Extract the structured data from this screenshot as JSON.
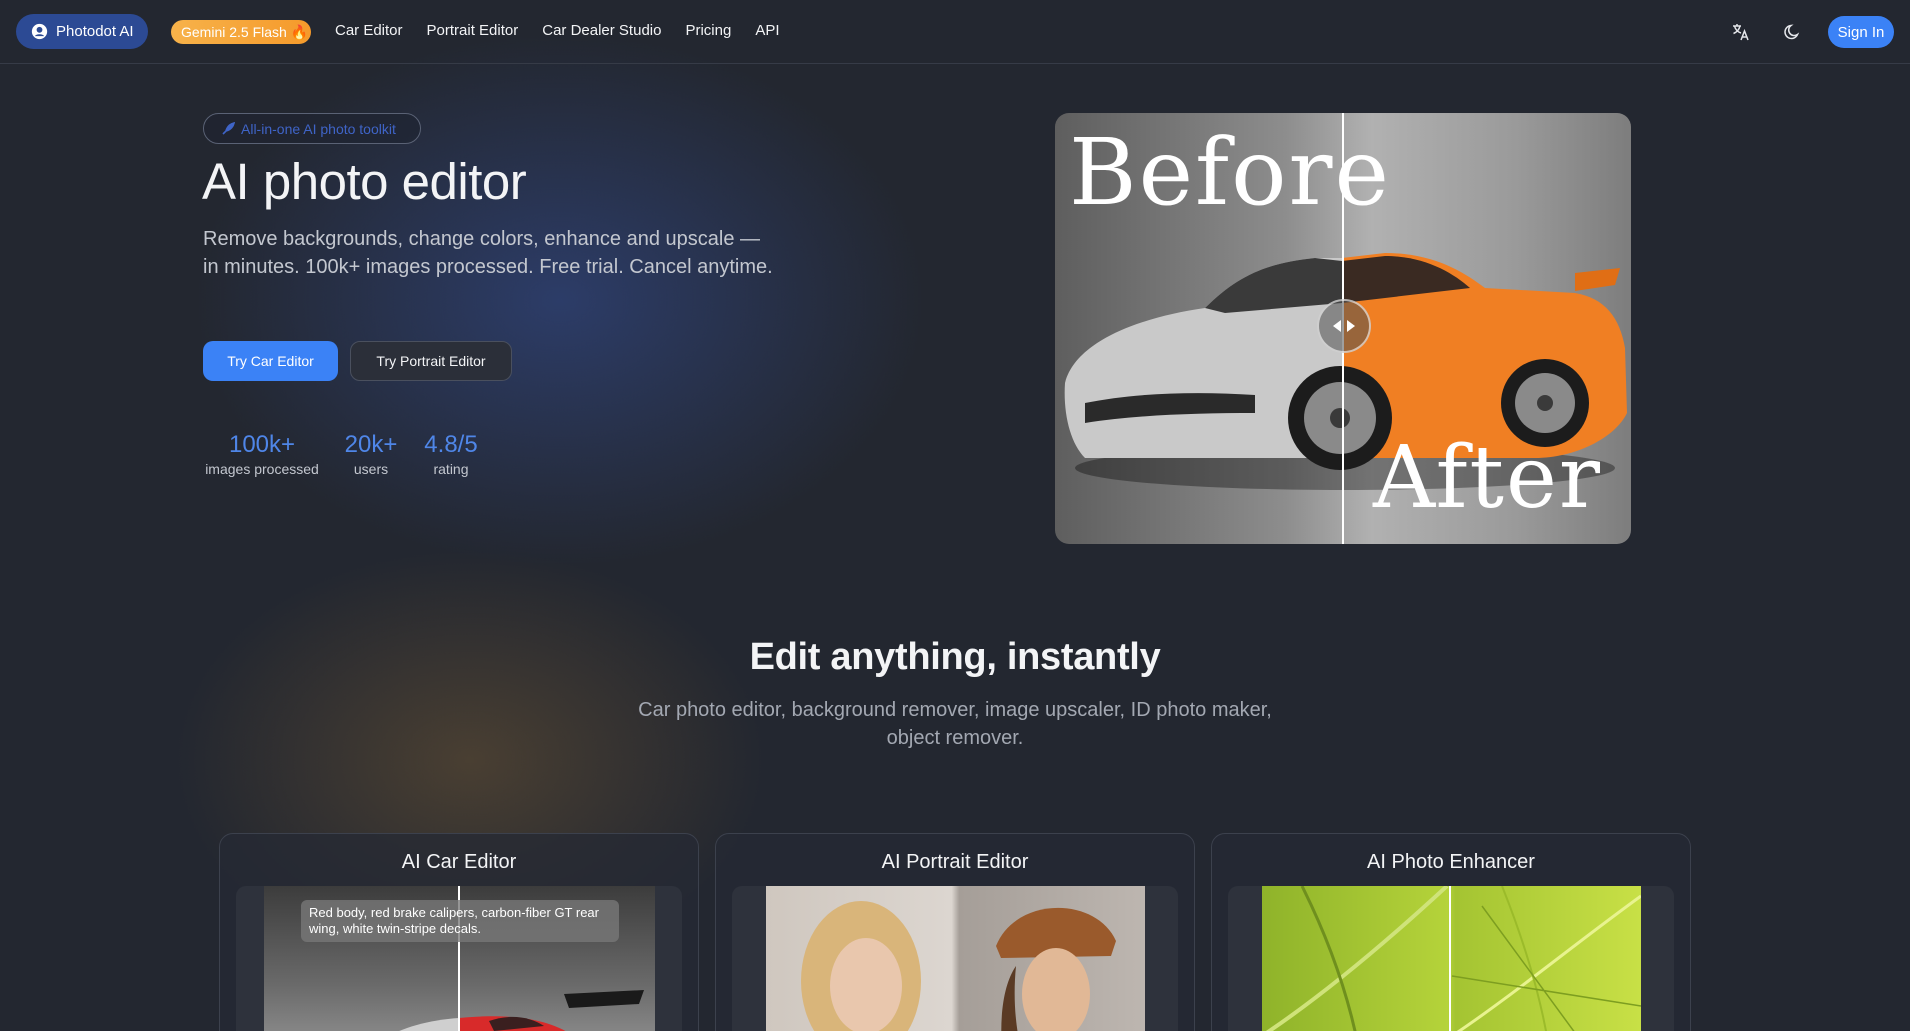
{
  "nav": {
    "brand": "Photodot AI",
    "badge": "Gemini 2.5 Flash 🔥",
    "links": [
      "Car Editor",
      "Portrait Editor",
      "Car Dealer Studio",
      "Pricing",
      "API"
    ],
    "sign_in": "Sign In"
  },
  "hero": {
    "pill": "All-in-one AI photo toolkit",
    "title": "AI photo editor",
    "subtitle": "Remove backgrounds, change colors, enhance and upscale — in minutes. 100k+ images processed. Free trial. Cancel anytime.",
    "primary_cta": "Try Car Editor",
    "secondary_cta": "Try Portrait Editor",
    "stats": [
      {
        "value": "100k+",
        "label": "images processed"
      },
      {
        "value": "20k+",
        "label": "users"
      },
      {
        "value": "4.8/5",
        "label": "rating"
      }
    ],
    "compare": {
      "before": "Before",
      "after": "After"
    }
  },
  "section": {
    "title": "Edit anything, instantly",
    "subtitle": "Car photo editor, background remover, image upscaler, ID photo maker, object remover."
  },
  "cards": [
    {
      "title": "AI Car Editor",
      "caption": "Red body, red brake calipers, carbon-fiber GT rear wing, white twin-stripe decals."
    },
    {
      "title": "AI Portrait Editor"
    },
    {
      "title": "AI Photo Enhancer"
    }
  ],
  "colors": {
    "accent": "#3b82f6",
    "brand_pill": "#2c4a94",
    "badge_orange": "#f59a2b",
    "stat_blue": "#4f86e8",
    "background": "#232730"
  },
  "icons": [
    "user-icon",
    "fire-icon",
    "translate-icon",
    "moon-icon",
    "rocket-icon",
    "arrow-left-icon",
    "arrow-right-icon"
  ]
}
